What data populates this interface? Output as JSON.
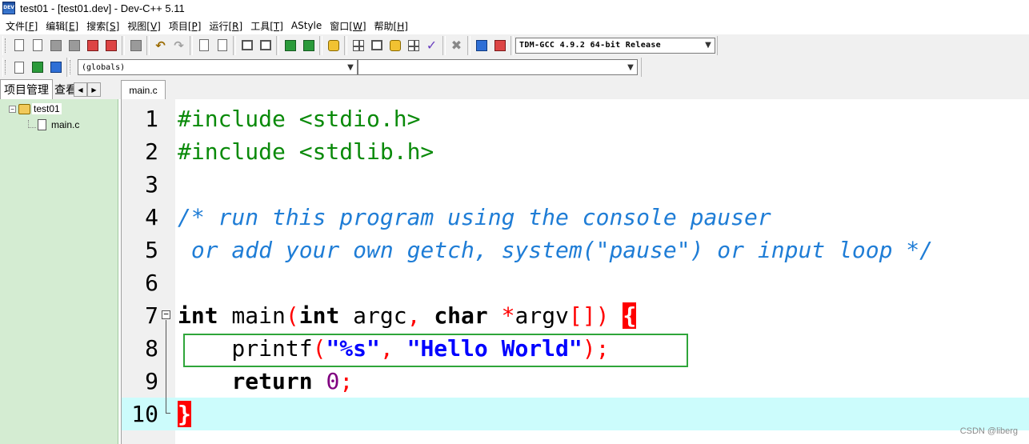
{
  "window": {
    "title": "test01 - [test01.dev] - Dev-C++ 5.11",
    "app_icon": "dev-cpp-icon",
    "app_icon_text": "DEV"
  },
  "menu": [
    {
      "label": "文件",
      "key": "[F]"
    },
    {
      "label": "编辑",
      "key": "[E]"
    },
    {
      "label": "搜索",
      "key": "[S]"
    },
    {
      "label": "视图",
      "key": "[V]"
    },
    {
      "label": "项目",
      "key": "[P]"
    },
    {
      "label": "运行",
      "key": "[R]"
    },
    {
      "label": "工具",
      "key": "[T]"
    },
    {
      "label": "AStyle",
      "key": ""
    },
    {
      "label": "窗口",
      "key": "[W]"
    },
    {
      "label": "帮助",
      "key": "[H]"
    }
  ],
  "toolbar": {
    "compiler_select": "TDM-GCC 4.9.2 64-bit Release",
    "scope_select": "(globals)",
    "member_select": ""
  },
  "left_panel": {
    "tabs": [
      "项目管理",
      "查看"
    ],
    "tree": {
      "project": "test01",
      "files": [
        "main.c"
      ]
    }
  },
  "editor": {
    "tab": "main.c",
    "line_numbers": [
      "1",
      "2",
      "3",
      "4",
      "5",
      "6",
      "7",
      "8",
      "9",
      "10"
    ],
    "current_line": 10
  },
  "watermark": "CSDN @liberg"
}
